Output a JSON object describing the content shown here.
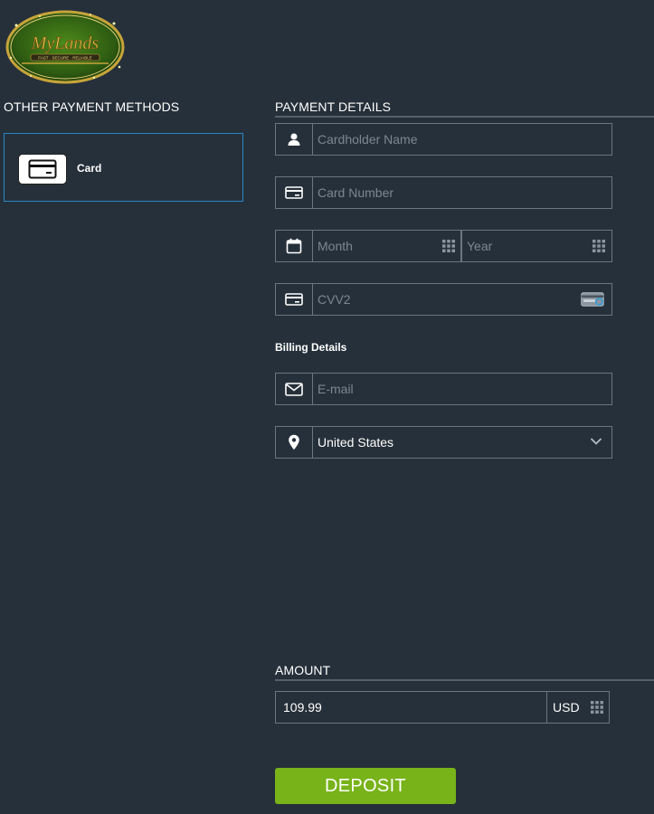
{
  "logo": {
    "brand_text": "MyLands",
    "sub_text": "FAST · SECURE · RELIABLE"
  },
  "payment_methods": {
    "heading": "OTHER PAYMENT METHODS",
    "items": [
      {
        "label": "Card",
        "icon": "credit-card-icon",
        "selected": true
      }
    ]
  },
  "payment_details": {
    "heading": "PAYMENT DETAILS",
    "cardholder_name": {
      "placeholder": "Cardholder Name",
      "value": "",
      "icon": "user-icon"
    },
    "card_number": {
      "placeholder": "Card Number",
      "value": "",
      "icon": "credit-card-icon"
    },
    "month": {
      "placeholder": "Month",
      "value": "",
      "icon": "calendar-icon"
    },
    "year": {
      "placeholder": "Year",
      "value": ""
    },
    "cvv": {
      "placeholder": "CVV2",
      "value": "",
      "icon": "credit-card-icon"
    }
  },
  "billing": {
    "heading": "Billing Details",
    "email": {
      "placeholder": "E-mail",
      "value": "",
      "icon": "envelope-icon"
    },
    "country": {
      "value": "United States",
      "icon": "map-pin-icon"
    }
  },
  "amount": {
    "heading": "AMOUNT",
    "value": "109.99",
    "currency": "USD"
  },
  "deposit_button": {
    "label": "DEPOSIT"
  },
  "colors": {
    "background": "#26303a",
    "border": "#6b7682",
    "selected_border": "#2a86c8",
    "deposit_green": "#78b31a",
    "placeholder": "#7c8793"
  }
}
